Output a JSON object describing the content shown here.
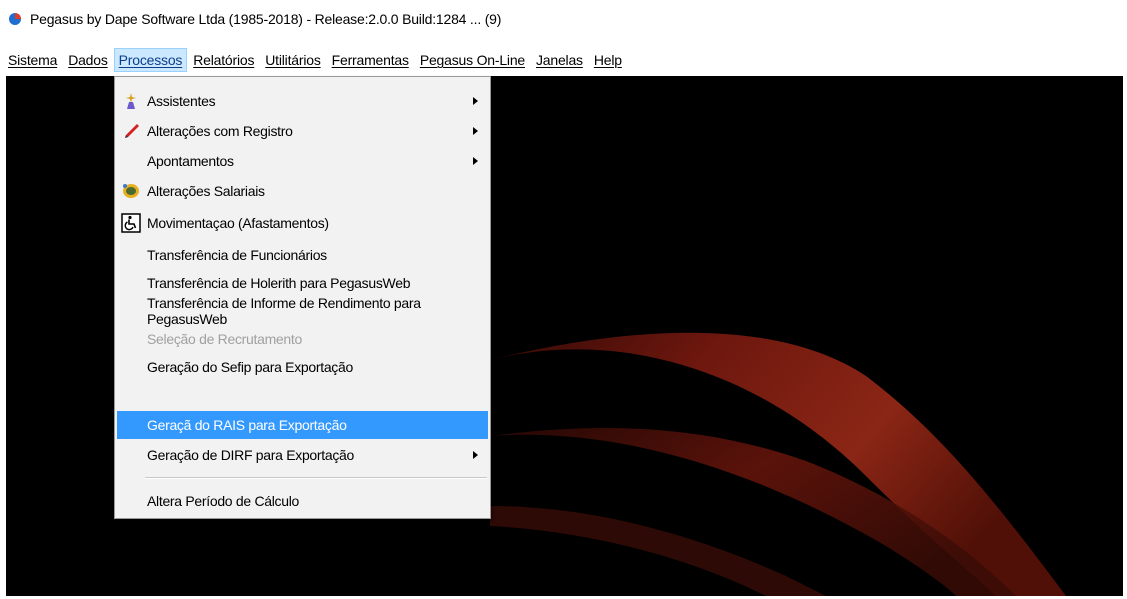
{
  "window": {
    "title": "Pegasus by Dape Software Ltda (1985-2018) - Release:2.0.0  Build:1284 ... (9)"
  },
  "menubar": {
    "items": [
      {
        "label": "Sistema"
      },
      {
        "label": "Dados"
      },
      {
        "label": "Processos"
      },
      {
        "label": "Relatórios"
      },
      {
        "label": "Utilitários"
      },
      {
        "label": "Ferramentas"
      },
      {
        "label": "Pegasus On-Line"
      },
      {
        "label": "Janelas"
      },
      {
        "label": "Help"
      }
    ],
    "active": "Processos"
  },
  "dropdown": {
    "items": [
      {
        "label": "Assistentes",
        "icon": "wizard-icon",
        "submenu": true
      },
      {
        "label": "Alterações com Registro",
        "icon": "pencil-icon",
        "submenu": true
      },
      {
        "label": "Apontamentos",
        "icon": "",
        "submenu": true
      },
      {
        "label": "Alterações Salariais",
        "icon": "salary-icon",
        "submenu": false
      },
      {
        "label": "Movimentaçao (Afastamentos)",
        "icon": "wheelchair-icon",
        "submenu": false
      },
      {
        "label": "Transferência de Funcionários",
        "icon": "",
        "submenu": false
      },
      {
        "label": "Transferência de Holerith para PegasusWeb",
        "icon": "",
        "submenu": false
      },
      {
        "label": "Transferência de Informe de Rendimento para PegasusWeb",
        "icon": "",
        "submenu": false
      },
      {
        "label": "Seleção de Recrutamento",
        "icon": "",
        "submenu": false,
        "disabled": true
      },
      {
        "label": "Geração do Sefip para Exportação",
        "icon": "",
        "submenu": false
      },
      {
        "label": "Geraçã do RAIS para Exportação",
        "icon": "",
        "submenu": false,
        "highlighted": true
      },
      {
        "label": "Geração de DIRF para Exportação",
        "icon": "",
        "submenu": true
      },
      {
        "label": "Altera Período de Cálculo",
        "icon": "",
        "submenu": false
      }
    ]
  },
  "colors": {
    "workspace": "#000000",
    "highlight": "#3399ff",
    "swoosh": "#8a1f12"
  }
}
